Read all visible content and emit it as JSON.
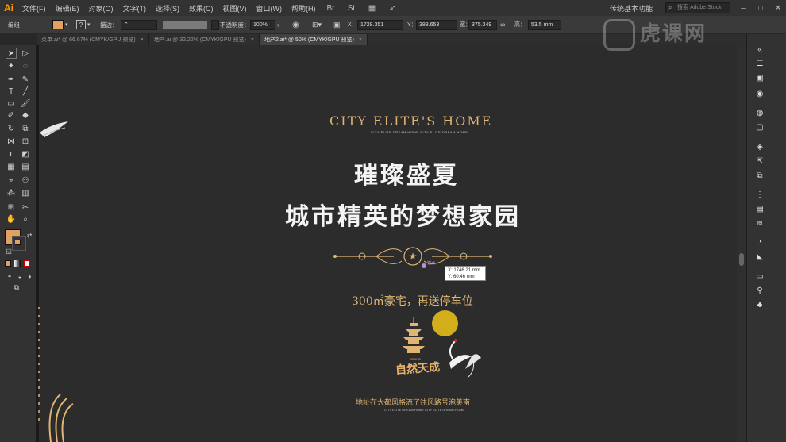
{
  "app": {
    "logo": "Ai"
  },
  "menu": [
    "文件(F)",
    "编辑(E)",
    "对象(O)",
    "文字(T)",
    "选择(S)",
    "效果(C)",
    "视图(V)",
    "窗口(W)",
    "帮助(H)"
  ],
  "menu_icons": [
    "bridge-icon",
    "stock-icon",
    "arrange-icon",
    "gpu-icon"
  ],
  "bridge_label": "Br",
  "stock_label": "St",
  "workspace": "传统基本功能",
  "search": {
    "placeholder": "搜索 Adobe Stock"
  },
  "control": {
    "mode_label": "编组",
    "stroke_label": "描边：",
    "opacity_label": "不透明度：",
    "opacity_value": "100%",
    "x_label": "X：",
    "x_value": "1728.351",
    "y_label": "Y：",
    "y_value": "388.653",
    "w_label": "宽：",
    "w_value": "375.349",
    "h_label": "高：",
    "h_value": "53.5 mm",
    "fill_color": "#e0a162"
  },
  "tabs": [
    {
      "label": "菜单.ai* @ 66.67% (CMYK/GPU 预览)",
      "active": false
    },
    {
      "label": "地产.ai @ 32.22% (CMYK/GPU 预览)",
      "active": false
    },
    {
      "label": "地产2.ai* @ 50% (CMYK/GPU 预览)",
      "active": true
    }
  ],
  "artboard": {
    "heading": "CITY ELITE'S HOME",
    "subheading": "CITY ELITE DREAM HOME CITY ELITE DREAM HOME",
    "title_line1": "璀璨盛夏",
    "title_line2": "城市精英的梦想家园",
    "offer": "300㎡豪宅，再送停车位",
    "brand": "自然天成",
    "brand_small": "BRAND",
    "address": "地址在大都风格流了往风路号泡美南",
    "address_small": "CITY ELITE DREAM HOME CITY ELITE DREAM HOME",
    "accent_color": "#e0b574",
    "moon_color": "#d4ad1a"
  },
  "cursor_tooltip": {
    "x": "X: 1746.21 mm",
    "y": "Y: 60.46 mm"
  },
  "anchor_label": "锚点",
  "watermark": "虎课网"
}
